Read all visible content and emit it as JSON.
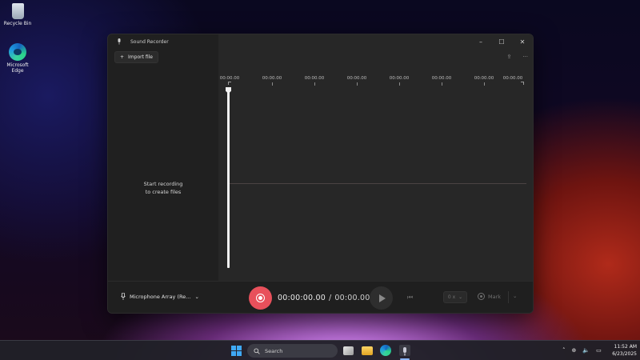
{
  "desktop": {
    "icons": [
      {
        "label": "Recycle Bin",
        "icon": "recycle-bin-icon"
      },
      {
        "label": "Microsoft Edge",
        "icon": "edge-icon"
      }
    ]
  },
  "window": {
    "title": "Sound Recorder",
    "controls": {
      "minimize": "–",
      "maximize": "☐",
      "close": "✕"
    }
  },
  "left_pane": {
    "import_label": "Import file",
    "empty_line1": "Start recording",
    "empty_line2": "to create files"
  },
  "timeline": {
    "labels": [
      "00:00.00",
      "00:00.00",
      "00:00.00",
      "00:00.00",
      "00:00.00",
      "00:00.00",
      "00:00.00",
      "00:00.00"
    ]
  },
  "top_actions": {
    "share_icon": "share-icon",
    "more": "···"
  },
  "bottom_bar": {
    "microphone": "Microphone Array (Re...",
    "elapsed": "00:00:00.00",
    "separator": "/",
    "total": "00:00.00",
    "speed": "0 x",
    "mark": "Mark"
  },
  "taskbar": {
    "search": "Search",
    "time": "11:52 AM",
    "date": "6/23/2025"
  },
  "colors": {
    "record": "#e8505b",
    "window_bg": "#202020",
    "pane_bg": "#272727"
  }
}
